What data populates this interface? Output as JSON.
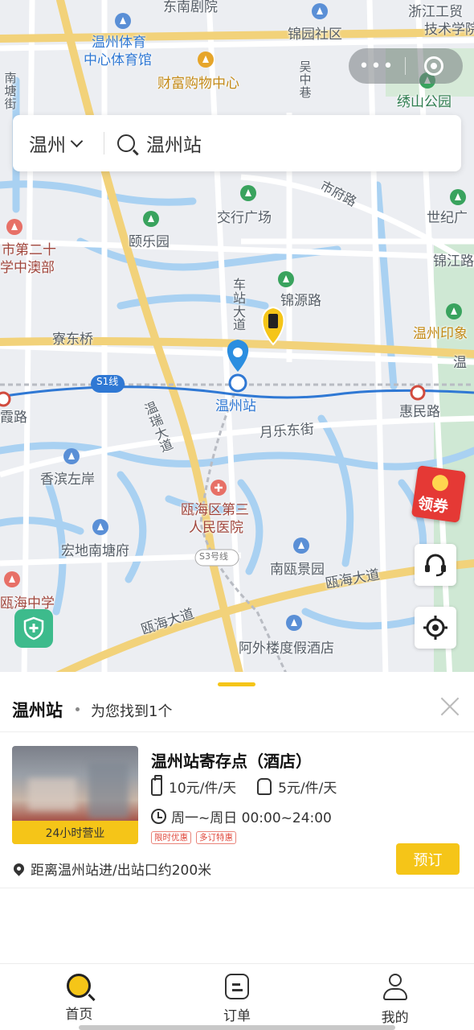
{
  "map": {
    "labels": {
      "dongnan_theater": "东南剧院",
      "zhejiang_trade_1": "浙江工贸",
      "zhejiang_trade_2": "技术学院",
      "wenzhou_gym_1": "温州体育",
      "wenzhou_gym_2": "中心体育馆",
      "jinyuan_community": "锦园社区",
      "caifu_mall": "财富购物中心",
      "nantang": "南塘街",
      "wuzhong_alley": "吴中巷",
      "xiushan_park": "绣山公园",
      "jiaoxing_square": "交行广场",
      "shifu_road": "市府路",
      "century_square": "世纪广",
      "yile_garden": "颐乐园",
      "school_20_1": "市第二十",
      "school_20_2": "学中澳部",
      "jinjiang_road": "锦江路",
      "station_avenue": "车站大道",
      "jinyuan_road": "锦源路",
      "wenzhou_impression": "温州印象",
      "liaodong_bridge": "寮东桥",
      "s1_line": "S1线",
      "wenzhou_station": "温州站",
      "huimin_road": "惠民路",
      "xia_road": "霞路",
      "wenrui_avenue": "温瑞大道",
      "yuele_east_street": "月乐东街",
      "xiangbin_zuoan": "香滨左岸",
      "ouhai_hospital_1": "瓯海区第三",
      "ouhai_hospital_2": "人民医院",
      "hongdi_nantang": "宏地南塘府",
      "s3_line": "S3号线",
      "nanou_jingyuan": "南瓯景园",
      "ouhai_avenue_1": "瓯海大道",
      "ouhai_avenue_2": "瓯海大道",
      "ouhai_school": "瓯海中学",
      "awailou_hotel": "阿外楼度假酒店",
      "wen_partial": "温"
    },
    "top_capsule": {
      "more": "•••"
    },
    "coupon_label": "领券"
  },
  "search": {
    "city": "温州",
    "query": "温州站"
  },
  "results": {
    "title": "温州站",
    "found_text": "为您找到1个"
  },
  "store": {
    "name": "温州站寄存点（酒店）",
    "badge": "24小时营业",
    "price_luggage": "10元/件/天",
    "price_bag": "5元/件/天",
    "hours": "周一~周日 00:00~24:00",
    "tags": [
      "限时优惠",
      "多订特惠"
    ],
    "distance": "距离温州站进/出站口约200米",
    "book_label": "预订"
  },
  "tabbar": {
    "home": "首页",
    "orders": "订单",
    "me": "我的"
  },
  "colors": {
    "accent": "#f5c518",
    "metro_blue": "#2f78d4",
    "tag_red": "#e0483c"
  }
}
